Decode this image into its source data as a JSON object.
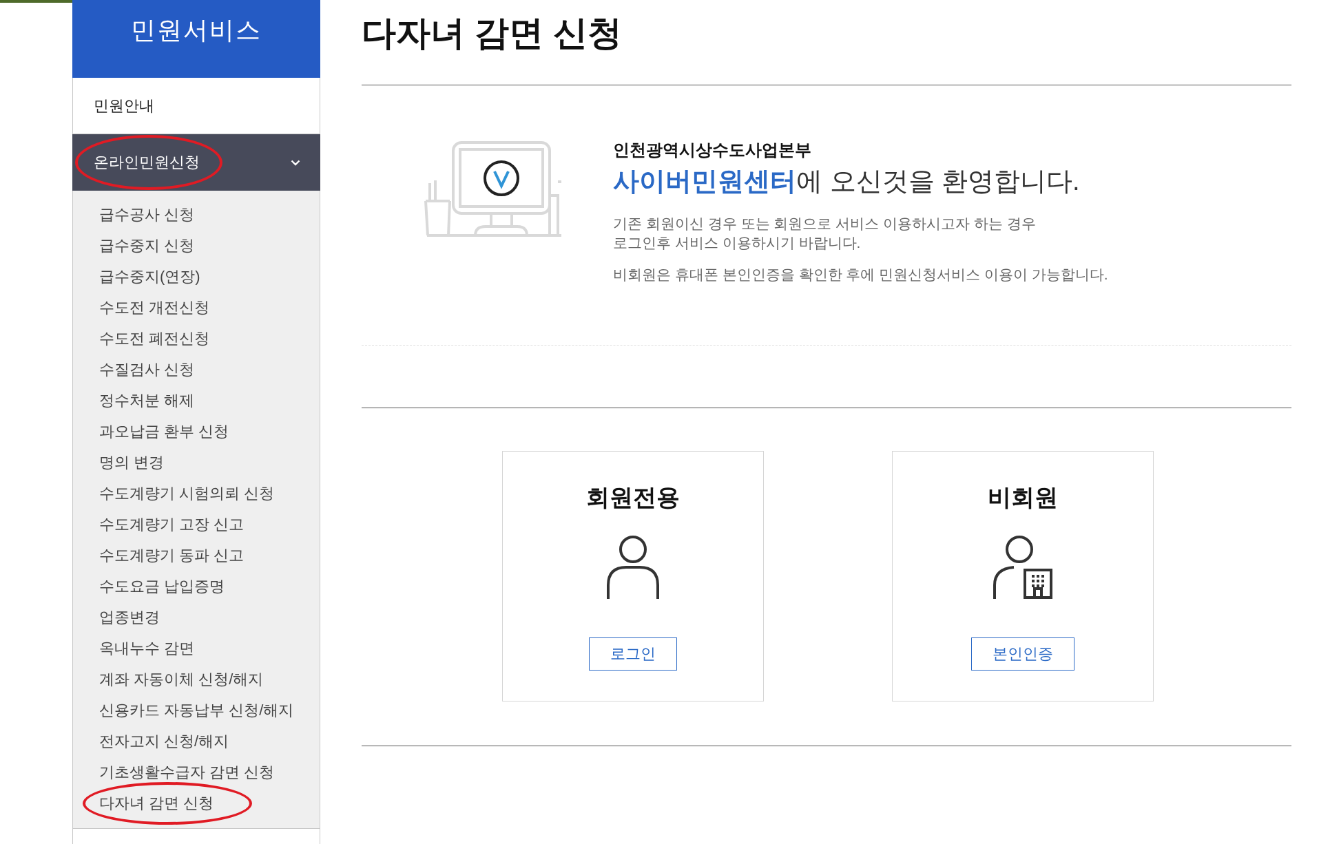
{
  "sidebar": {
    "title": "민원서비스",
    "items": [
      {
        "label": "민원안내",
        "expanded": false,
        "circled": false
      },
      {
        "label": "온라인민원신청",
        "expanded": true,
        "circled": true,
        "children": [
          {
            "label": "급수공사 신청",
            "circled": false
          },
          {
            "label": "급수중지 신청",
            "circled": false
          },
          {
            "label": "급수중지(연장)",
            "circled": false
          },
          {
            "label": "수도전 개전신청",
            "circled": false
          },
          {
            "label": "수도전 폐전신청",
            "circled": false
          },
          {
            "label": "수질검사 신청",
            "circled": false
          },
          {
            "label": "정수처분 해제",
            "circled": false
          },
          {
            "label": "과오납금 환부 신청",
            "circled": false
          },
          {
            "label": "명의 변경",
            "circled": false
          },
          {
            "label": "수도계량기 시험의뢰 신청",
            "circled": false
          },
          {
            "label": "수도계량기 고장 신고",
            "circled": false
          },
          {
            "label": "수도계량기 동파 신고",
            "circled": false
          },
          {
            "label": "수도요금 납입증명",
            "circled": false
          },
          {
            "label": "업종변경",
            "circled": false
          },
          {
            "label": "옥내누수 감면",
            "circled": false
          },
          {
            "label": "계좌 자동이체 신청/해지",
            "circled": false
          },
          {
            "label": "신용카드 자동납부 신청/해지",
            "circled": false
          },
          {
            "label": "전자고지 신청/해지",
            "circled": false
          },
          {
            "label": "기초생활수급자 감면 신청",
            "circled": false
          },
          {
            "label": "다자녀 감면 신청",
            "circled": true
          }
        ]
      }
    ]
  },
  "page_title": "다자녀 감면 신청",
  "welcome": {
    "org": "인천광역시상수도사업본부",
    "headline": "**사이버민원센터**에 오신것을 환영합니다.",
    "paragraphs": [
      "기존 회원이신 경우 또는 회원으로 서비스 이용하시고자 하는 경우\n로그인후 서비스 이용하시기 바랍니다.",
      "비회원은 휴대폰 본인인증을 확인한 후에 민원신청서비스 이용이 가능합니다."
    ]
  },
  "cards": [
    {
      "kind": "member",
      "title": "회원전용",
      "button": "로그인"
    },
    {
      "kind": "guest",
      "title": "비회원",
      "button": "본인인증"
    }
  ]
}
